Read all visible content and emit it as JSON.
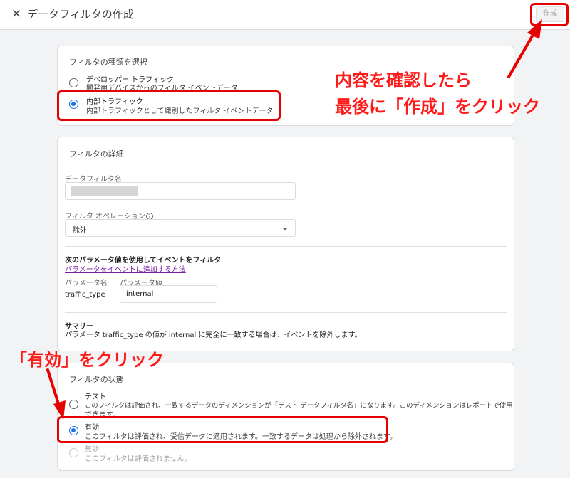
{
  "header": {
    "title": "データフィルタの作成",
    "create_label": "作成"
  },
  "filter_type": {
    "heading": "フィルタの種類を選択",
    "options": [
      {
        "title": "デベロッパー トラフィック",
        "desc": "開発用デバイスからのフィルタ イベントデータ",
        "selected": false
      },
      {
        "title": "内部トラフィック",
        "desc": "内部トラフィックとして識別したフィルタ イベントデータ",
        "selected": true
      }
    ]
  },
  "details": {
    "heading": "フィルタの詳細",
    "name_label": "データフィルタ名",
    "name_value": "",
    "operation_label": "フィルタ オペレーション",
    "operation_value": "除外",
    "param_heading": "次のパラメータ値を使用してイベントをフィルタ",
    "param_link": "パラメータをイベントに追加する方法",
    "param_name_label": "パラメータ名",
    "param_value_label": "パラメータ値",
    "param_name": "traffic_type",
    "param_value": "internal",
    "summary_heading": "サマリー",
    "summary_text": "パラメータ traffic_type の値が internal に完全に一致する場合は、イベントを除外します。"
  },
  "status": {
    "heading": "フィルタの状態",
    "options": [
      {
        "title": "テスト",
        "desc1": "このフィルタは評価され、一致するデータのディメンションが「テスト データフィルタ名」になります。このディメンションはレポートで使用",
        "desc2": "できます。",
        "selected": false
      },
      {
        "title": "有効",
        "desc": "このフィルタは評価され、受信データに適用されます。一致するデータは処理から除外されます。",
        "selected": true
      },
      {
        "title": "無効",
        "desc": "このフィルタは評価されません。",
        "selected": false
      }
    ]
  },
  "annotations": {
    "top_line1": "内容を確認したら",
    "top_line2": "最後に「作成」をクリック",
    "bottom": "「有効」をクリック",
    "color": "#e60000"
  }
}
